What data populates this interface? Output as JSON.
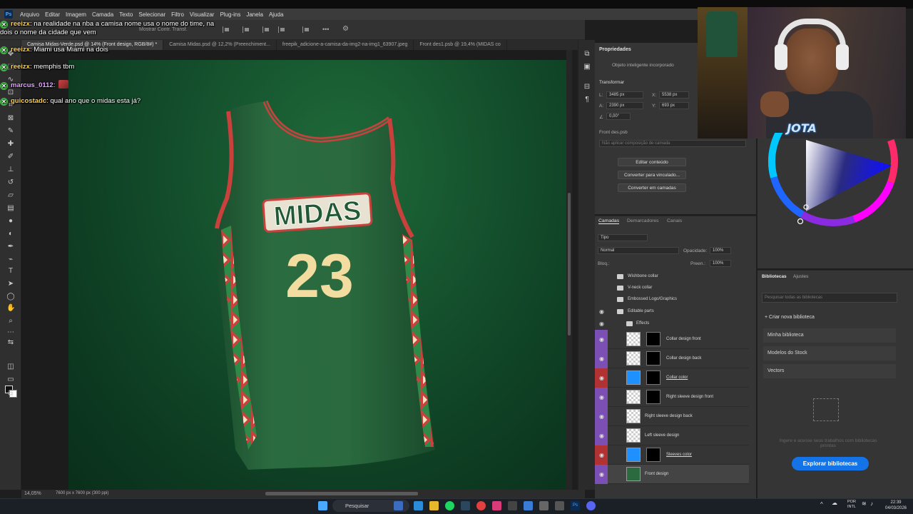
{
  "menu": {
    "app_icon": "Ps",
    "items": [
      "Arquivo",
      "Editar",
      "Imagem",
      "Camada",
      "Texto",
      "Selecionar",
      "Filtro",
      "Visualizar",
      "Plug-ins",
      "Janela",
      "Ajuda"
    ]
  },
  "options_bar": {
    "show_transform": "Mostrar Contr. Transf."
  },
  "tabs": [
    {
      "label": "Camisa Midas-Verde.psd @ 14% (Front design, RGB/8#) *",
      "active": true
    },
    {
      "label": "Camisa Midas.psd @ 12,2% (Preenchiment...",
      "active": false
    },
    {
      "label": "freepik_adicione-a-camisa-da-img2-na-img1_63907.jpeg",
      "active": false
    },
    {
      "label": "Front des1.psb @ 19,4% (MIDAS co",
      "active": false
    }
  ],
  "chat": [
    {
      "user": "reeizx",
      "user_color": "#ffd24a",
      "message": "na realidade na nba a camisa nome usa o nome do time, na dois o nome da cidade que vem"
    },
    {
      "user": "reeizx",
      "user_color": "#ffd24a",
      "message": "Miami usa Miami na dois"
    },
    {
      "user": "reeizx",
      "user_color": "#ffd24a",
      "message": "memphis tbm"
    },
    {
      "user": "marcus_0112",
      "user_color": "#e0a6ff",
      "message": ""
    },
    {
      "user": "guicostadc",
      "user_color": "#ffd24a",
      "message": "qual ano que o midas esta já?"
    }
  ],
  "jersey": {
    "text": "MIDAS",
    "number": "23",
    "body_color": "#2a6a3e",
    "trim_color": "#c8413d",
    "number_color": "#f2dca0"
  },
  "status": {
    "zoom": "14,05%",
    "doc_size": "7600 px x 7600 px (300 ppi)"
  },
  "properties": {
    "title": "Propriedades",
    "object_type": "Objeto inteligente incorporado",
    "transform_label": "Transformar",
    "w_label": "L:",
    "w_value": "3485 px",
    "h_label": "A:",
    "h_value": "2390 px",
    "x_label": "X:",
    "x_value": "5538 px",
    "y_label": "Y:",
    "y_value": "693 px",
    "angle_value": "0,00°",
    "file_name": "Front des.psb",
    "comp_placeholder": "Não aplicar composição de camada",
    "buttons": [
      "Editar conteúdo",
      "Converter para vinculado...",
      "Converter em camadas"
    ]
  },
  "layers_panel": {
    "tabs": [
      "Camadas",
      "Demarcadores",
      "Canais"
    ],
    "filter_label": "Tipo",
    "blend_mode": "Normal",
    "opacity_label": "Opacidade:",
    "opacity_value": "100%",
    "lock_label": "Bloq.:",
    "fill_label": "Preen.:",
    "fill_value": "100%",
    "groups": [
      "Wishbone collar",
      "V-neck collar",
      "Embossed Logo/Graphics",
      "Editable parts",
      "Effects"
    ],
    "layers": [
      {
        "name": "Collar design front",
        "color": "#7b4fb3"
      },
      {
        "name": "Collar design back",
        "color": "#7b4fb3"
      },
      {
        "name": "Collar color",
        "color": "#b03232"
      },
      {
        "name": "Right sleeve design front",
        "color": "#7b4fb3"
      },
      {
        "name": "Right sleeve design back",
        "color": "#7b4fb3"
      },
      {
        "name": "Left sleeve design",
        "color": "#7b4fb3"
      },
      {
        "name": "Sleeves color",
        "color": "#b03232"
      },
      {
        "name": "Front design",
        "color": "#7b4fb3"
      }
    ]
  },
  "webcam": {
    "logo_text": "JOTA"
  },
  "libraries": {
    "tabs": [
      "Bibliotecas",
      "Ajustes"
    ],
    "search_placeholder": "Pesquisar todas as bibliotecas",
    "create_label": "Criar nova biblioteca",
    "items": [
      "Minha biblioteca",
      "Modelos do Stock",
      "Vectors"
    ],
    "empty_text": "Ingere e acesse seus trabalhos com bibliotecas prontas",
    "explore_button": "Explorar bibliotecas"
  },
  "taskbar": {
    "search_label": "Pesquisar",
    "lang": "POR\nINTL",
    "time": "22:39",
    "date": "04/03/2026"
  }
}
